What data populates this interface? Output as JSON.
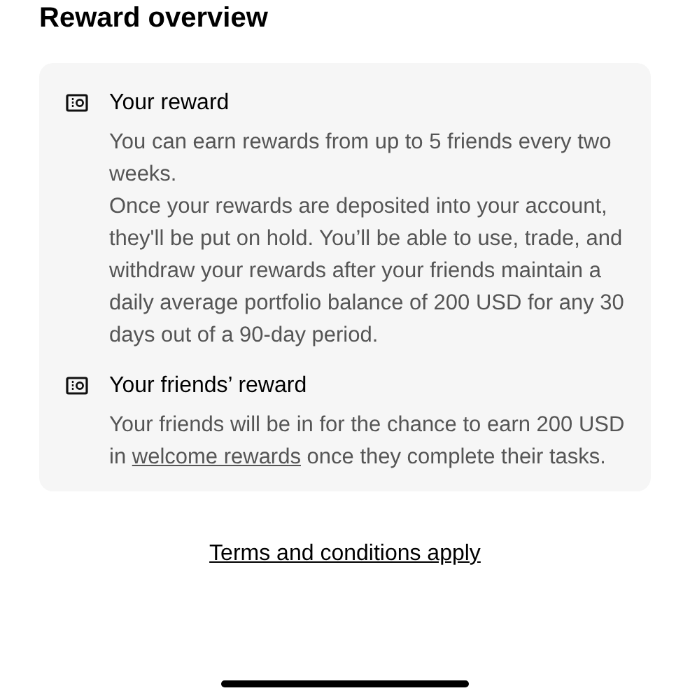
{
  "title": "Reward overview",
  "sections": [
    {
      "heading": "Your reward",
      "paragraphs": [
        {
          "before": "You can earn rewards from up to 5 friends every two weeks."
        },
        {
          "before": "Once your rewards are deposited into your account, they'll be put on hold. You’ll be able to use, trade, and withdraw your rewards after your friends maintain a daily average portfolio balance of 200 USD for any 30 days out of a 90-day period."
        }
      ]
    },
    {
      "heading": "Your friends’ reward",
      "paragraphs": [
        {
          "before": "Your friends will be in for the chance to earn 200 USD in ",
          "link": "welcome rewards",
          "after": " once they complete their tasks."
        }
      ]
    }
  ],
  "terms_link": "Terms and conditions apply"
}
